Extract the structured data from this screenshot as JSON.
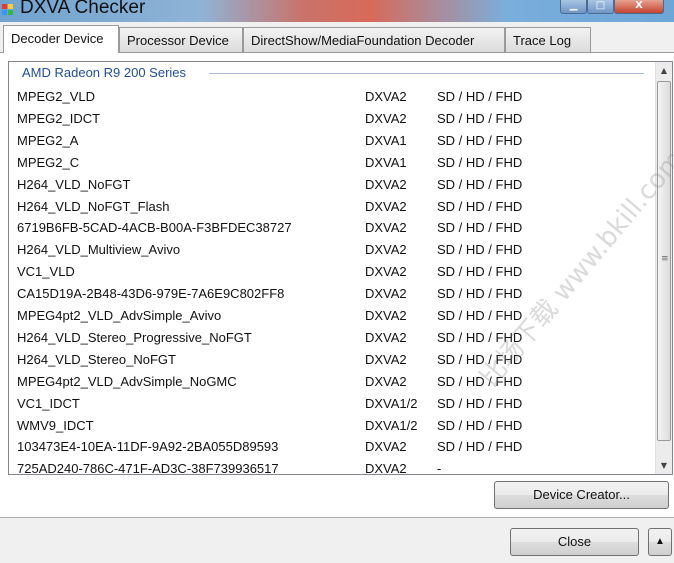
{
  "window": {
    "title": "DXVA Checker",
    "minimize": "▁",
    "maximize": "□",
    "close": "X"
  },
  "tabs": [
    {
      "label": "Decoder Device"
    },
    {
      "label": "Processor Device"
    },
    {
      "label": "DirectShow/MediaFoundation Decoder"
    },
    {
      "label": "Trace Log"
    }
  ],
  "group": "AMD Radeon R9 200 Series",
  "rows": [
    {
      "name": "MPEG2_VLD",
      "api": "DXVA2",
      "res": "SD / HD / FHD"
    },
    {
      "name": "MPEG2_IDCT",
      "api": "DXVA2",
      "res": "SD / HD / FHD"
    },
    {
      "name": "MPEG2_A",
      "api": "DXVA1",
      "res": "SD / HD / FHD"
    },
    {
      "name": "MPEG2_C",
      "api": "DXVA1",
      "res": "SD / HD / FHD"
    },
    {
      "name": "H264_VLD_NoFGT",
      "api": "DXVA2",
      "res": "SD / HD / FHD"
    },
    {
      "name": "H264_VLD_NoFGT_Flash",
      "api": "DXVA2",
      "res": "SD / HD / FHD"
    },
    {
      "name": "6719B6FB-5CAD-4ACB-B00A-F3BFDEC38727",
      "api": "DXVA2",
      "res": "SD / HD / FHD"
    },
    {
      "name": "H264_VLD_Multiview_Avivo",
      "api": "DXVA2",
      "res": "SD / HD / FHD"
    },
    {
      "name": "VC1_VLD",
      "api": "DXVA2",
      "res": "SD / HD / FHD"
    },
    {
      "name": "CA15D19A-2B48-43D6-979E-7A6E9C802FF8",
      "api": "DXVA2",
      "res": "SD / HD / FHD"
    },
    {
      "name": "MPEG4pt2_VLD_AdvSimple_Avivo",
      "api": "DXVA2",
      "res": "SD / HD / FHD"
    },
    {
      "name": "H264_VLD_Stereo_Progressive_NoFGT",
      "api": "DXVA2",
      "res": "SD / HD / FHD"
    },
    {
      "name": "H264_VLD_Stereo_NoFGT",
      "api": "DXVA2",
      "res": "SD / HD / FHD"
    },
    {
      "name": "MPEG4pt2_VLD_AdvSimple_NoGMC",
      "api": "DXVA2",
      "res": "SD / HD / FHD"
    },
    {
      "name": "VC1_IDCT",
      "api": "DXVA1/2",
      "res": "SD / HD / FHD"
    },
    {
      "name": "WMV9_IDCT",
      "api": "DXVA1/2",
      "res": "SD / HD / FHD"
    },
    {
      "name": "103473E4-10EA-11DF-9A92-2BA055D89593",
      "api": "DXVA2",
      "res": "SD / HD / FHD"
    },
    {
      "name": "725AD240-786C-471F-AD3C-38F739936517",
      "api": "DXVA2",
      "res": "-"
    }
  ],
  "buttons": {
    "device_creator": "Device Creator...",
    "close": "Close",
    "expand": "▲"
  },
  "scrollbar": {
    "up": "▲",
    "down": "▼",
    "grip": "≡"
  },
  "watermark": "比场下载 www.bkill.com"
}
